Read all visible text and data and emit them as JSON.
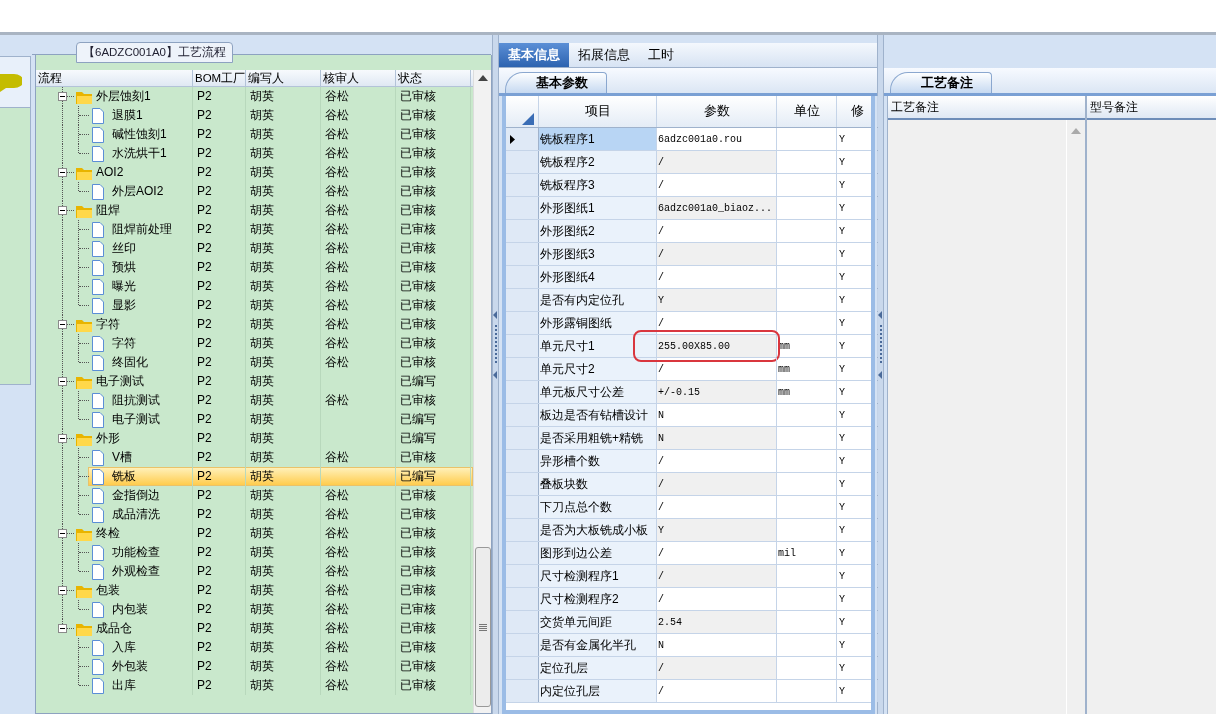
{
  "left_panel": {
    "group_title": "【6ADZC001A0】工艺流程",
    "columns": [
      "流程",
      "BOM工厂",
      "编写人",
      "核审人",
      "状态"
    ],
    "nodes": [
      {
        "label": "外层蚀刻1",
        "kind": "folder",
        "expanded": true,
        "bom": "P2",
        "author": "胡英",
        "reviewer": "谷松",
        "status": "已审核",
        "selected": false,
        "children": [
          {
            "label": "退膜1",
            "kind": "file",
            "bom": "P2",
            "author": "胡英",
            "reviewer": "谷松",
            "status": "已审核",
            "selected": false
          },
          {
            "label": "碱性蚀刻1",
            "kind": "file",
            "bom": "P2",
            "author": "胡英",
            "reviewer": "谷松",
            "status": "已审核",
            "selected": false
          },
          {
            "label": "水洗烘干1",
            "kind": "file",
            "bom": "P2",
            "author": "胡英",
            "reviewer": "谷松",
            "status": "已审核",
            "selected": false
          }
        ]
      },
      {
        "label": "AOI2",
        "kind": "folder",
        "expanded": true,
        "bom": "P2",
        "author": "胡英",
        "reviewer": "谷松",
        "status": "已审核",
        "selected": false,
        "children": [
          {
            "label": "外层AOI2",
            "kind": "file",
            "bom": "P2",
            "author": "胡英",
            "reviewer": "谷松",
            "status": "已审核",
            "selected": false
          }
        ]
      },
      {
        "label": "阻焊",
        "kind": "folder",
        "expanded": true,
        "bom": "P2",
        "author": "胡英",
        "reviewer": "谷松",
        "status": "已审核",
        "selected": false,
        "children": [
          {
            "label": "阻焊前处理",
            "kind": "file",
            "bom": "P2",
            "author": "胡英",
            "reviewer": "谷松",
            "status": "已审核",
            "selected": false
          },
          {
            "label": "丝印",
            "kind": "file",
            "bom": "P2",
            "author": "胡英",
            "reviewer": "谷松",
            "status": "已审核",
            "selected": false
          },
          {
            "label": "预烘",
            "kind": "file",
            "bom": "P2",
            "author": "胡英",
            "reviewer": "谷松",
            "status": "已审核",
            "selected": false
          },
          {
            "label": "曝光",
            "kind": "file",
            "bom": "P2",
            "author": "胡英",
            "reviewer": "谷松",
            "status": "已审核",
            "selected": false
          },
          {
            "label": "显影",
            "kind": "file",
            "bom": "P2",
            "author": "胡英",
            "reviewer": "谷松",
            "status": "已审核",
            "selected": false
          }
        ]
      },
      {
        "label": "字符",
        "kind": "folder",
        "expanded": true,
        "bom": "P2",
        "author": "胡英",
        "reviewer": "谷松",
        "status": "已审核",
        "selected": false,
        "children": [
          {
            "label": "字符",
            "kind": "file",
            "bom": "P2",
            "author": "胡英",
            "reviewer": "谷松",
            "status": "已审核",
            "selected": false
          },
          {
            "label": "终固化",
            "kind": "file",
            "bom": "P2",
            "author": "胡英",
            "reviewer": "谷松",
            "status": "已审核",
            "selected": false
          }
        ]
      },
      {
        "label": "电子测试",
        "kind": "folder",
        "expanded": true,
        "bom": "P2",
        "author": "胡英",
        "status": "已编写",
        "selected": false,
        "children": [
          {
            "label": "阻抗测试",
            "kind": "file",
            "bom": "P2",
            "author": "胡英",
            "reviewer": "谷松",
            "status": "已审核",
            "selected": false
          },
          {
            "label": "电子测试",
            "kind": "file",
            "bom": "P2",
            "author": "胡英",
            "status": "已编写",
            "selected": false
          }
        ]
      },
      {
        "label": "外形",
        "kind": "folder",
        "expanded": true,
        "bom": "P2",
        "author": "胡英",
        "status": "已编写",
        "selected": false,
        "children": [
          {
            "label": "V槽",
            "kind": "file",
            "bom": "P2",
            "author": "胡英",
            "reviewer": "谷松",
            "status": "已审核",
            "selected": false
          },
          {
            "label": "铣板",
            "kind": "file",
            "bom": "P2",
            "author": "胡英",
            "status": "已编写",
            "selected": true
          },
          {
            "label": "金指倒边",
            "kind": "file",
            "bom": "P2",
            "author": "胡英",
            "reviewer": "谷松",
            "status": "已审核",
            "selected": false
          },
          {
            "label": "成品清洗",
            "kind": "file",
            "bom": "P2",
            "author": "胡英",
            "reviewer": "谷松",
            "status": "已审核",
            "selected": false
          }
        ]
      },
      {
        "label": "终检",
        "kind": "folder",
        "expanded": true,
        "bom": "P2",
        "author": "胡英",
        "reviewer": "谷松",
        "status": "已审核",
        "selected": false,
        "children": [
          {
            "label": "功能检查",
            "kind": "file",
            "bom": "P2",
            "author": "胡英",
            "reviewer": "谷松",
            "status": "已审核",
            "selected": false
          },
          {
            "label": "外观检查",
            "kind": "file",
            "bom": "P2",
            "author": "胡英",
            "reviewer": "谷松",
            "status": "已审核",
            "selected": false
          }
        ]
      },
      {
        "label": "包装",
        "kind": "folder",
        "expanded": true,
        "bom": "P2",
        "author": "胡英",
        "reviewer": "谷松",
        "status": "已审核",
        "selected": false,
        "children": [
          {
            "label": "内包装",
            "kind": "file",
            "bom": "P2",
            "author": "胡英",
            "reviewer": "谷松",
            "status": "已审核",
            "selected": false
          }
        ]
      },
      {
        "label": "成品仓",
        "kind": "folder",
        "expanded": true,
        "bom": "P2",
        "author": "胡英",
        "reviewer": "谷松",
        "status": "已审核",
        "selected": false,
        "children": [
          {
            "label": "入库",
            "kind": "file",
            "bom": "P2",
            "author": "胡英",
            "reviewer": "谷松",
            "status": "已审核",
            "selected": false
          },
          {
            "label": "外包装",
            "kind": "file",
            "bom": "P2",
            "author": "胡英",
            "reviewer": "谷松",
            "status": "已审核",
            "selected": false
          },
          {
            "label": "出库",
            "kind": "file",
            "bom": "P2",
            "author": "胡英",
            "reviewer": "谷松",
            "status": "已审核",
            "selected": false
          }
        ]
      }
    ]
  },
  "middle_panel": {
    "tabs": [
      {
        "label": "基本信息",
        "selected": true
      },
      {
        "label": "拓展信息",
        "selected": false
      },
      {
        "label": "工时",
        "selected": false
      }
    ],
    "subtab": "基本参数",
    "columns": [
      "项目",
      "参数",
      "单位",
      "修"
    ],
    "rows": [
      {
        "item": "铣板程序1",
        "value": "6adzc001a0.rou",
        "modified": "Y",
        "current": true,
        "highlighted": false
      },
      {
        "item": "铣板程序2",
        "value": "/",
        "modified": "Y",
        "current": false,
        "highlighted": false
      },
      {
        "item": "铣板程序3",
        "value": "/",
        "modified": "Y",
        "current": false,
        "highlighted": false
      },
      {
        "item": "外形图纸1",
        "value": "6adzc001a0_biaoz...",
        "modified": "Y",
        "current": false,
        "highlighted": false
      },
      {
        "item": "外形图纸2",
        "value": "/",
        "modified": "Y",
        "current": false,
        "highlighted": false
      },
      {
        "item": "外形图纸3",
        "value": "/",
        "modified": "Y",
        "current": false,
        "highlighted": false
      },
      {
        "item": "外形图纸4",
        "value": "/",
        "modified": "Y",
        "current": false,
        "highlighted": false
      },
      {
        "item": "是否有内定位孔",
        "value": "Y",
        "modified": "Y",
        "current": false,
        "highlighted": false
      },
      {
        "item": "外形露铜图纸",
        "value": "/",
        "modified": "Y",
        "current": false,
        "highlighted": false
      },
      {
        "item": "单元尺寸1",
        "value": "255.00X85.00",
        "unit": "mm",
        "modified": "Y",
        "current": false,
        "highlighted": true
      },
      {
        "item": "单元尺寸2",
        "value": "/",
        "unit": "mm",
        "modified": "Y",
        "current": false,
        "highlighted": false
      },
      {
        "item": "单元板尺寸公差",
        "value": "+/-0.15",
        "unit": "mm",
        "modified": "Y",
        "current": false,
        "highlighted": false
      },
      {
        "item": "板边是否有钻槽设计",
        "value": "N",
        "modified": "Y",
        "current": false,
        "highlighted": false
      },
      {
        "item": "是否采用粗铣+精铣",
        "value": "N",
        "modified": "Y",
        "current": false,
        "highlighted": false
      },
      {
        "item": "异形槽个数",
        "value": "/",
        "modified": "Y",
        "current": false,
        "highlighted": false
      },
      {
        "item": "叠板块数",
        "value": "/",
        "modified": "Y",
        "current": false,
        "highlighted": false
      },
      {
        "item": "下刀点总个数",
        "value": "/",
        "modified": "Y",
        "current": false,
        "highlighted": false
      },
      {
        "item": "是否为大板铣成小板",
        "value": "Y",
        "modified": "Y",
        "current": false,
        "highlighted": false
      },
      {
        "item": "图形到边公差",
        "value": "/",
        "unit": "mil",
        "modified": "Y",
        "current": false,
        "highlighted": false
      },
      {
        "item": "尺寸检测程序1",
        "value": "/",
        "modified": "Y",
        "current": false,
        "highlighted": false
      },
      {
        "item": "尺寸检测程序2",
        "value": "/",
        "modified": "Y",
        "current": false,
        "highlighted": false
      },
      {
        "item": "交货单元间距",
        "value": "2.54",
        "modified": "Y",
        "current": false,
        "highlighted": false
      },
      {
        "item": "是否有金属化半孔",
        "value": "N",
        "modified": "Y",
        "current": false,
        "highlighted": false
      },
      {
        "item": "定位孔层",
        "value": "/",
        "modified": "Y",
        "current": false,
        "highlighted": false
      },
      {
        "item": "内定位孔层",
        "value": "/",
        "modified": "Y",
        "current": false,
        "highlighted": false
      }
    ]
  },
  "right_panel": {
    "subtab": "工艺备注",
    "columns": [
      "工艺备注",
      "型号备注"
    ]
  }
}
